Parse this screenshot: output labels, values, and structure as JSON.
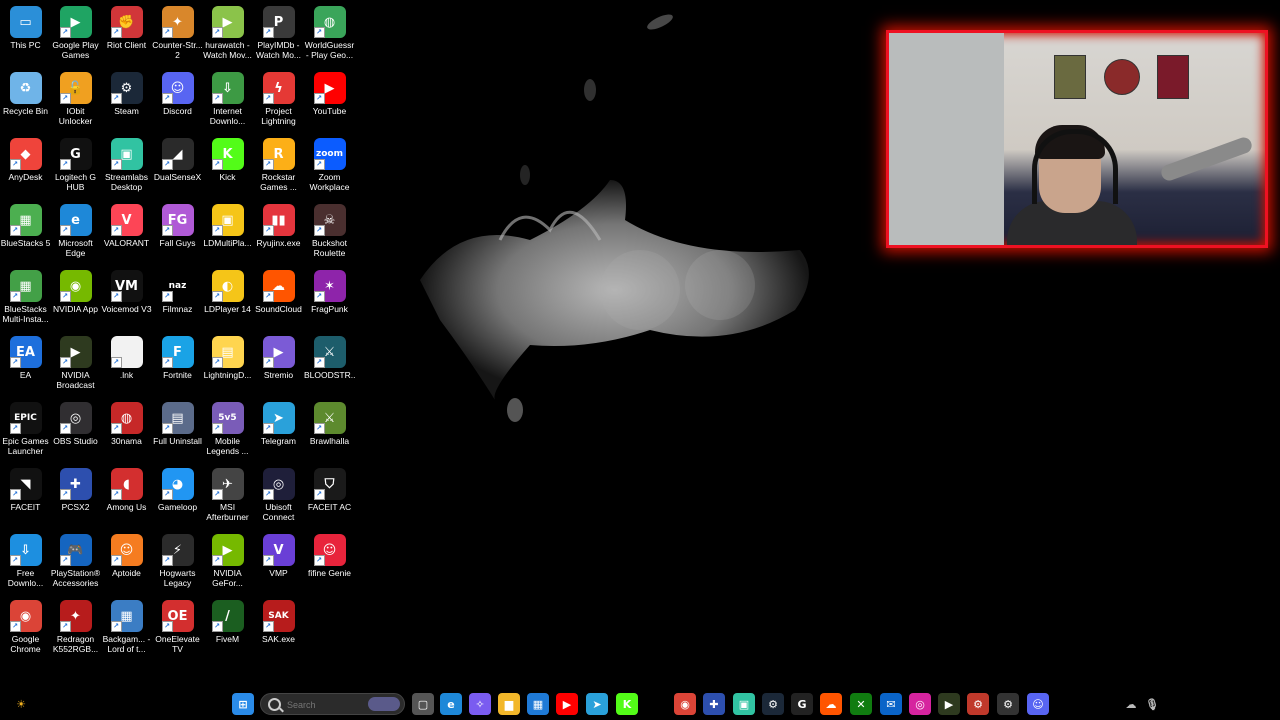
{
  "desktop": {
    "icons": [
      {
        "label": "This PC",
        "color": "#2b8fd8",
        "glyph": "▭",
        "shortcut": false
      },
      {
        "label": "Google Play Games",
        "color": "#1fa463",
        "glyph": "▶",
        "shortcut": true
      },
      {
        "label": "Riot Client",
        "color": "#d13639",
        "glyph": "✊",
        "shortcut": true
      },
      {
        "label": "Counter-Str... 2",
        "color": "#d9872b",
        "glyph": "✦",
        "shortcut": true
      },
      {
        "label": "hurawatch - Watch Mov...",
        "color": "#8bc34a",
        "glyph": "▶",
        "shortcut": true
      },
      {
        "label": "PlayIMDb - Watch Mo...",
        "color": "#3a3a3a",
        "glyph": "P",
        "shortcut": true
      },
      {
        "label": "WorldGuessr - Play Geo...",
        "color": "#3aa55a",
        "glyph": "◍",
        "shortcut": true
      },
      {
        "label": "Recycle Bin",
        "color": "#6fb4e8",
        "glyph": "♻",
        "shortcut": false
      },
      {
        "label": "IObit Unlocker",
        "color": "#f0a020",
        "glyph": "🔓",
        "shortcut": true
      },
      {
        "label": "Steam",
        "color": "#1b2838",
        "glyph": "⚙",
        "shortcut": true
      },
      {
        "label": "Discord",
        "color": "#5865f2",
        "glyph": "☺",
        "shortcut": true
      },
      {
        "label": "Internet Downlo...",
        "color": "#3d9a44",
        "glyph": "⇩",
        "shortcut": true
      },
      {
        "label": "Project Lightning",
        "color": "#e53935",
        "glyph": "ϟ",
        "shortcut": true
      },
      {
        "label": "YouTube",
        "color": "#ff0000",
        "glyph": "▶",
        "shortcut": true
      },
      {
        "label": "AnyDesk",
        "color": "#ef443b",
        "glyph": "◆",
        "shortcut": true
      },
      {
        "label": "Logitech G HUB",
        "color": "#111111",
        "glyph": "G",
        "shortcut": true
      },
      {
        "label": "Streamlabs Desktop",
        "color": "#31c3a2",
        "glyph": "▣",
        "shortcut": true
      },
      {
        "label": "DualSenseX",
        "color": "#2a2a2a",
        "glyph": "◢",
        "shortcut": true
      },
      {
        "label": "Kick",
        "color": "#53fc18",
        "glyph": "K",
        "shortcut": true
      },
      {
        "label": "Rockstar Games ...",
        "color": "#fcaf17",
        "glyph": "R",
        "shortcut": true
      },
      {
        "label": "Zoom Workplace",
        "color": "#0b5cff",
        "glyph": "zoom",
        "shortcut": true
      },
      {
        "label": "BlueStacks 5",
        "color": "#4caf50",
        "glyph": "▦",
        "shortcut": true
      },
      {
        "label": "Microsoft Edge",
        "color": "#1e88d8",
        "glyph": "e",
        "shortcut": true
      },
      {
        "label": "VALORANT",
        "color": "#fd4556",
        "glyph": "V",
        "shortcut": true
      },
      {
        "label": "Fall Guys",
        "color": "#b05ad6",
        "glyph": "FG",
        "shortcut": true
      },
      {
        "label": "LDMultiPla...",
        "color": "#f5c518",
        "glyph": "▣",
        "shortcut": true
      },
      {
        "label": "Ryujinx.exe",
        "color": "#e4353d",
        "glyph": "▮▮",
        "shortcut": true
      },
      {
        "label": "Buckshot Roulette",
        "color": "#4a2f2f",
        "glyph": "☠",
        "shortcut": true
      },
      {
        "label": "BlueStacks Multi-Insta...",
        "color": "#43a047",
        "glyph": "▦",
        "shortcut": true
      },
      {
        "label": "NVIDIA App",
        "color": "#76b900",
        "glyph": "◉",
        "shortcut": true
      },
      {
        "label": "Voicemod V3",
        "color": "#111111",
        "glyph": "VM",
        "shortcut": true
      },
      {
        "label": "Filmnaz",
        "color": "#000000",
        "glyph": "naz",
        "shortcut": true
      },
      {
        "label": "LDPlayer 14",
        "color": "#f5c518",
        "glyph": "◐",
        "shortcut": true
      },
      {
        "label": "SoundCloud",
        "color": "#ff5500",
        "glyph": "☁",
        "shortcut": true
      },
      {
        "label": "FragPunk",
        "color": "#8e24aa",
        "glyph": "✶",
        "shortcut": true
      },
      {
        "label": "EA",
        "color": "#1e6fdc",
        "glyph": "EA",
        "shortcut": true
      },
      {
        "label": "NVIDIA Broadcast",
        "color": "#2e3a1f",
        "glyph": "▶",
        "shortcut": true
      },
      {
        "label": ".lnk",
        "color": "#f2f2f2",
        "glyph": "",
        "shortcut": true
      },
      {
        "label": "Fortnite",
        "color": "#1aa3e6",
        "glyph": "F",
        "shortcut": true
      },
      {
        "label": "LightningD...",
        "color": "#ffd54f",
        "glyph": "▤",
        "shortcut": true
      },
      {
        "label": "Stremio",
        "color": "#7b5bd6",
        "glyph": "▶",
        "shortcut": true
      },
      {
        "label": "BLOODSTR...",
        "color": "#1d5d6b",
        "glyph": "⚔",
        "shortcut": true
      },
      {
        "label": "Epic Games Launcher",
        "color": "#111111",
        "glyph": "EPIC",
        "shortcut": true
      },
      {
        "label": "OBS Studio",
        "color": "#302e31",
        "glyph": "◎",
        "shortcut": true
      },
      {
        "label": "30nama",
        "color": "#c62828",
        "glyph": "◍",
        "shortcut": true
      },
      {
        "label": "Full Uninstall",
        "color": "#5b6b8a",
        "glyph": "▤",
        "shortcut": true
      },
      {
        "label": "Mobile Legends ...",
        "color": "#7a5cb8",
        "glyph": "5v5",
        "shortcut": true
      },
      {
        "label": "Telegram",
        "color": "#2aa1da",
        "glyph": "➤",
        "shortcut": true
      },
      {
        "label": "Brawlhalla",
        "color": "#5d8a2e",
        "glyph": "⚔",
        "shortcut": true
      },
      {
        "label": "FACEIT",
        "color": "#111111",
        "glyph": "◥",
        "shortcut": true
      },
      {
        "label": "PCSX2",
        "color": "#2d4fae",
        "glyph": "✚",
        "shortcut": true
      },
      {
        "label": "Among Us",
        "color": "#d32f2f",
        "glyph": "◖",
        "shortcut": true
      },
      {
        "label": "Gameloop",
        "color": "#2196f3",
        "glyph": "◕",
        "shortcut": true
      },
      {
        "label": "MSI Afterburner",
        "color": "#444444",
        "glyph": "✈",
        "shortcut": true
      },
      {
        "label": "Ubisoft Connect",
        "color": "#1f1f3a",
        "glyph": "◎",
        "shortcut": true
      },
      {
        "label": "FACEIT AC",
        "color": "#1a1a1a",
        "glyph": "⛉",
        "shortcut": true
      },
      {
        "label": "Free Downlo...",
        "color": "#1d8fe0",
        "glyph": "⇩",
        "shortcut": true
      },
      {
        "label": "PlayStation® Accessories",
        "color": "#1565c0",
        "glyph": "🎮",
        "shortcut": true
      },
      {
        "label": "Aptoide",
        "color": "#f57c20",
        "glyph": "☺",
        "shortcut": true
      },
      {
        "label": "Hogwarts Legacy",
        "color": "#2b2b2b",
        "glyph": "⚡",
        "shortcut": true
      },
      {
        "label": "NVIDIA GeFor...",
        "color": "#76b900",
        "glyph": "▶",
        "shortcut": true
      },
      {
        "label": "VMP",
        "color": "#6a3fd6",
        "glyph": "V",
        "shortcut": true
      },
      {
        "label": "fifine Genie",
        "color": "#e8243c",
        "glyph": "☺",
        "shortcut": true
      },
      {
        "label": "Google Chrome",
        "color": "#db4437",
        "glyph": "◉",
        "shortcut": true
      },
      {
        "label": "Redragon K552RGB...",
        "color": "#b71c1c",
        "glyph": "✦",
        "shortcut": true
      },
      {
        "label": "Backgam... - Lord of t...",
        "color": "#3b7dc4",
        "glyph": "▦",
        "shortcut": true
      },
      {
        "label": "OneElevate TV",
        "color": "#d32f2f",
        "glyph": "OE",
        "shortcut": true
      },
      {
        "label": "FiveM",
        "color": "#1b5e20",
        "glyph": "/",
        "shortcut": true
      },
      {
        "label": "SAK.exe",
        "color": "#b71c1c",
        "glyph": "SAK",
        "shortcut": true
      }
    ]
  },
  "webcam": {
    "frame_color": "#e81a1a"
  },
  "taskbar": {
    "search_placeholder": "Search",
    "left_item": {
      "name": "weather-icon",
      "glyph": "☀",
      "color": "#f0b020"
    },
    "items": [
      {
        "name": "start-button",
        "glyph": "⊞",
        "color": "#2a8be8"
      },
      {
        "name": "task-view-icon",
        "glyph": "▢",
        "color": "#555555"
      },
      {
        "name": "edge-icon",
        "glyph": "e",
        "color": "#1e88d8"
      },
      {
        "name": "copilot-icon",
        "glyph": "✧",
        "color": "#7a5cf0"
      },
      {
        "name": "file-explorer-icon",
        "glyph": "▆",
        "color": "#f2b72a"
      },
      {
        "name": "store-icon",
        "glyph": "▦",
        "color": "#1f7ad6"
      },
      {
        "name": "youtube-icon",
        "glyph": "▶",
        "color": "#ff0000"
      },
      {
        "name": "telegram-icon",
        "glyph": "➤",
        "color": "#2aa1da"
      },
      {
        "name": "kick-icon",
        "glyph": "K",
        "color": "#53fc18"
      },
      {
        "name": "chrome-icon",
        "glyph": "◉",
        "color": "#db4437"
      },
      {
        "name": "pcsx2-icon",
        "glyph": "✚",
        "color": "#2d4fae"
      },
      {
        "name": "streamlabs-icon",
        "glyph": "▣",
        "color": "#31c3a2"
      },
      {
        "name": "steam-icon",
        "glyph": "⚙",
        "color": "#1b2838"
      },
      {
        "name": "logitech-icon",
        "glyph": "G",
        "color": "#222222"
      },
      {
        "name": "soundcloud-icon",
        "glyph": "☁",
        "color": "#ff5500"
      },
      {
        "name": "xbox-icon",
        "glyph": "✕",
        "color": "#107c10"
      },
      {
        "name": "outlook-icon",
        "glyph": "✉",
        "color": "#0a64c8"
      },
      {
        "name": "instagram-icon",
        "glyph": "◎",
        "color": "#d6249f"
      },
      {
        "name": "nvidia-broadcast-icon",
        "glyph": "▶",
        "color": "#2e3a1f"
      },
      {
        "name": "steam-active-icon",
        "glyph": "⚙",
        "color": "#c0392b"
      },
      {
        "name": "settings-icon",
        "glyph": "⚙",
        "color": "#333333"
      },
      {
        "name": "discord-icon",
        "glyph": "☺",
        "color": "#5865f2"
      }
    ],
    "tray": [
      {
        "name": "onedrive-icon",
        "glyph": "☁",
        "color": "#000000"
      },
      {
        "name": "microphone-icon",
        "glyph": "🎙",
        "color": "#000000"
      }
    ]
  }
}
